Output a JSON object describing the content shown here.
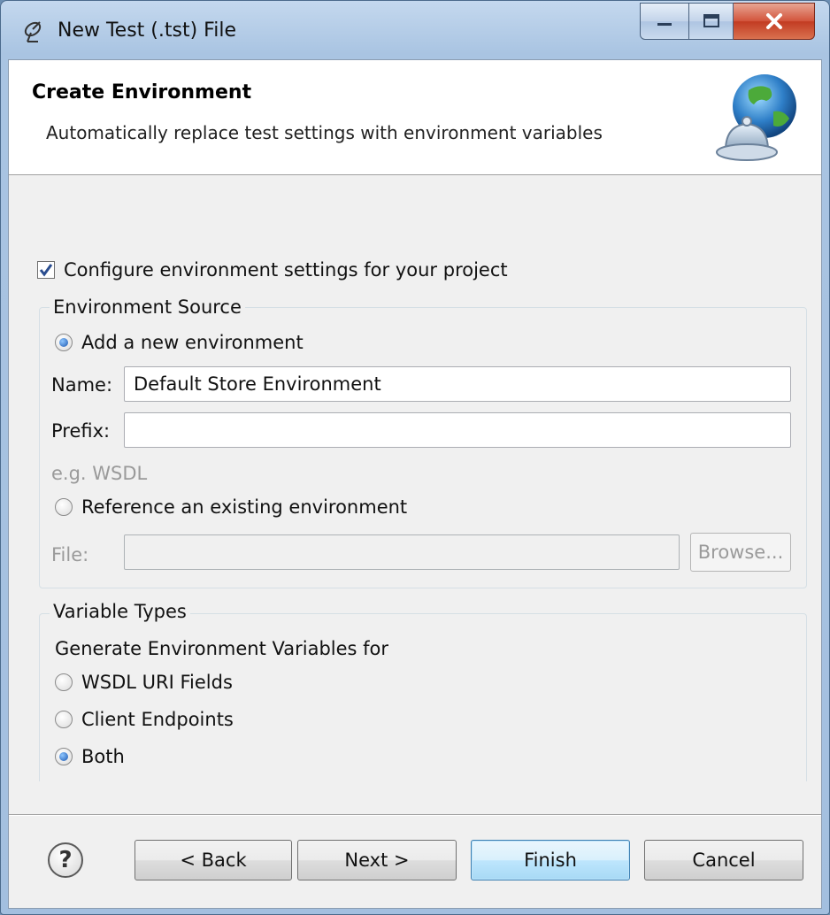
{
  "window": {
    "title": "New Test (.tst) File"
  },
  "banner": {
    "title": "Create Environment",
    "description": "Automatically replace test settings with environment variables"
  },
  "configure": {
    "label": "Configure environment settings for your project",
    "checked": true
  },
  "environment_source": {
    "legend": "Environment Source",
    "add_new_label": "Add a new environment",
    "add_new_selected": true,
    "name_label": "Name:",
    "name_value": "Default Store Environment",
    "prefix_label": "Prefix:",
    "prefix_value": "",
    "hint": "e.g. WSDL",
    "reference_label": "Reference an existing environment",
    "reference_selected": false,
    "file_label": "File:",
    "file_value": "",
    "browse_label": "Browse..."
  },
  "variable_types": {
    "legend": "Variable Types",
    "intro": "Generate Environment Variables for",
    "options": [
      {
        "label": "WSDL URI Fields",
        "selected": false
      },
      {
        "label": "Client Endpoints",
        "selected": false
      },
      {
        "label": "Both",
        "selected": true
      }
    ]
  },
  "footer": {
    "back_label": "< Back",
    "next_label": "Next >",
    "finish_label": "Finish",
    "cancel_label": "Cancel"
  },
  "icons": {
    "app": "satellite-dish-icon",
    "banner": "globe-bell-icon",
    "help": "help-icon"
  },
  "colors": {
    "titlebar": "#a9c4e2",
    "close_button": "#c23b22",
    "default_button": "#bee6fd"
  }
}
